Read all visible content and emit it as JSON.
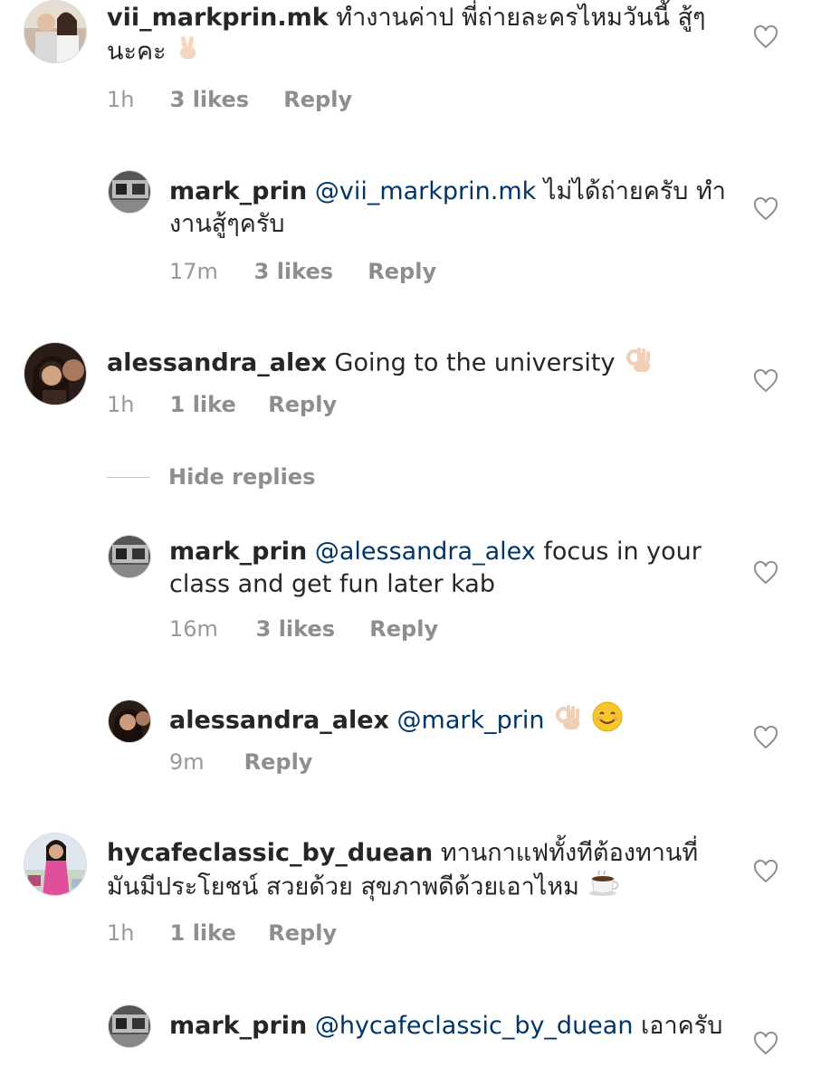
{
  "comments": [
    {
      "username": "vii_markprin.mk",
      "text": "ทำงานค่าป พี่ถ่ายละครไหมวันนี้ สู้ๆนะคะ",
      "emoji": "victory-hand",
      "time": "1h",
      "likes": "3 likes",
      "reply_label": "Reply",
      "avatar": "couple-photo-avatar"
    },
    {
      "username": "mark_prin",
      "mention": "@vii_markprin.mk",
      "text": "ไม่ได้ถ่ายครับ ทำงานสู้ๆครับ",
      "time": "17m",
      "likes": "3 likes",
      "reply_label": "Reply",
      "avatar": "bw-car-avatar"
    },
    {
      "username": "alessandra_alex",
      "text": "Going to the university",
      "emoji": "ok-hand",
      "time": "1h",
      "likes": "1 like",
      "reply_label": "Reply",
      "avatar": "woman-selfie-avatar"
    },
    {
      "username": "mark_prin",
      "mention": "@alessandra_alex",
      "text": "focus in your class and get fun later kab",
      "time": "16m",
      "likes": "3 likes",
      "reply_label": "Reply",
      "avatar": "bw-car-avatar"
    },
    {
      "username": "alessandra_alex",
      "mention": "@mark_prin",
      "emoji": "ok-hand smiling-face",
      "time": "9m",
      "reply_label": "Reply",
      "avatar": "woman-selfie-avatar"
    },
    {
      "username": "hycafeclassic_by_duean",
      "text": "ทานกาแฟทั้งทีต้องทานที่มันมีประโยชน์  สวยด้วย  สุขภาพดีด้วยเอาไหม",
      "emoji": "hot-beverage",
      "time": "1h",
      "likes": "1 like",
      "reply_label": "Reply",
      "avatar": "woman-pink-avatar"
    },
    {
      "username": "mark_prin",
      "mention": "@hycafeclassic_by_duean",
      "text": "เอาครับ",
      "avatar": "bw-car-avatar"
    }
  ],
  "hide_replies": "Hide replies",
  "colors": {
    "text": "#262626",
    "mention": "#003569",
    "meta": "#8e8e8e",
    "heart": "#8e8e8e"
  }
}
